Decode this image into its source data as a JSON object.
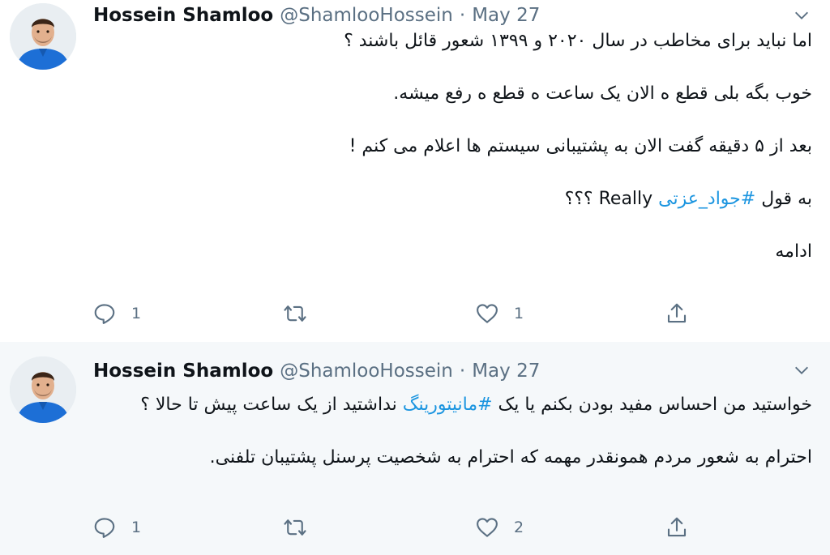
{
  "tweets": [
    {
      "author_name": "Hossein Shamloo",
      "handle": "@ShamlooHossein",
      "separator": "·",
      "date": "May 27",
      "lines": [
        "اما نباید برای مخاطب در سال ۲۰۲۰ و ۱۳۹۹ شعور قائل باشند ؟",
        "خوب بگه بلی قطع ه الان یک ساعت ه قطع ه رفع میشه.",
        "بعد از ۵ دقیقه گفت الان به پشتیبانی سیستم ها اعلام می کنم !",
        "ادامه"
      ],
      "mixed_line": {
        "prefix": "به قول ",
        "hashtag": "#جواد_عزتی",
        "suffix_ltr": "Really",
        "end": " ؟؟؟"
      },
      "reply_count": "1",
      "retweet_count": "",
      "like_count": "1"
    },
    {
      "author_name": "Hossein Shamloo",
      "handle": "@ShamlooHossein",
      "separator": "·",
      "date": "May 27",
      "line1_pre": "خواستید من احساس مفید بودن بکنم یا یک ",
      "hashtag": "#مانیتورینگ",
      "line1_post": " نداشتید از یک ساعت پیش تا حالا ؟",
      "line2": "احترام به شعور مردم همونقدر مهمه که احترام به شخصیت پرسنل پشتیبان تلفنی.",
      "reply_count": "1",
      "retweet_count": "",
      "like_count": "2"
    }
  ],
  "icons": {
    "reply": "speech-bubble-icon",
    "retweet": "retweet-arrows-icon",
    "like": "heart-icon",
    "share": "share-upload-icon",
    "menu": "chevron-down-icon"
  },
  "colors": {
    "link": "#1b95e0",
    "muted": "#5b7083",
    "thread_line": "#c4cfd6",
    "highlight_bg": "#f5f8fa"
  }
}
